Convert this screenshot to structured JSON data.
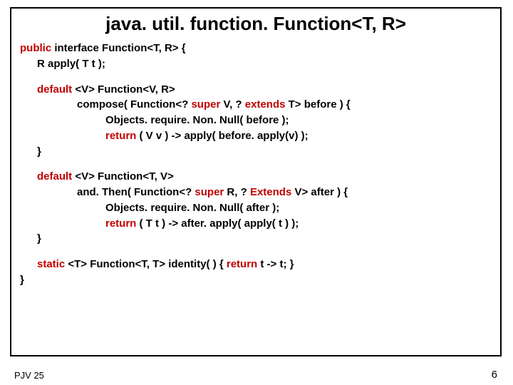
{
  "title": "java. util. function. Function<T, R>",
  "line1a": "public",
  "line1b": "  interface  Function<T, R>  {",
  "line2": "R  apply( T t );",
  "line3a": "default",
  "line3b": "  <V> Function<V, R>",
  "line4a": "compose( Function<?  ",
  "line4b": "super",
  "line4c": " V, ? ",
  "line4d": "extends",
  "line4e": " T> before )  {",
  "line5": "Objects. require. Non. Null( before );",
  "line6a": "return",
  "line6b": " ( V v )  ->  apply( before. apply(v) );",
  "line7": "}",
  "line8a": "default",
  "line8b": "  <V> Function<T, V>",
  "line9a": "and. Then( Function<?  ",
  "line9b": "super",
  "line9c": " R, ? ",
  "line9d": "Extends",
  "line9e": " V> after )  {",
  "line10": "Objects. require. Non. Null( after );",
  "line11a": "return",
  "line11b": " ( T t )  ->  after. apply( apply( t ) );",
  "line12": "}",
  "line13a": "static",
  "line13b": "  <T> Function<T, T> identity( )  { ",
  "line13c": "return",
  "line13d": " t -> t; }",
  "line14": "}",
  "footerLeft": "PJV 25",
  "footerRight": "6"
}
